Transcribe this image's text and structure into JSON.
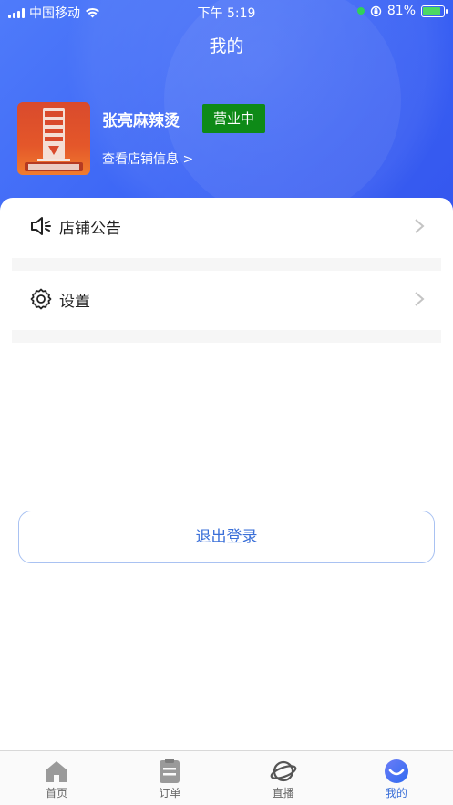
{
  "status_bar": {
    "carrier": "中国移动",
    "time": "下午 5:19",
    "battery": "81%",
    "battery_level": 0.81
  },
  "header": {
    "title": "我的"
  },
  "store": {
    "name": "张亮麻辣烫",
    "status": "营业中",
    "info_link": "查看店铺信息 >",
    "logo_icon": "zhangliang-malatang-logo"
  },
  "menu": {
    "items": [
      {
        "label": "店铺公告",
        "icon": "speaker-icon"
      },
      {
        "label": "设置",
        "icon": "gear-icon"
      }
    ]
  },
  "logout_label": "退出登录",
  "tabbar": {
    "tabs": [
      {
        "label": "首页",
        "icon": "home-icon",
        "active": false
      },
      {
        "label": "订单",
        "icon": "order-icon",
        "active": false
      },
      {
        "label": "直播",
        "icon": "planet-icon",
        "active": false
      },
      {
        "label": "我的",
        "icon": "profile-icon",
        "active": true
      }
    ]
  },
  "colors": {
    "primary": "#3a63f5",
    "status_green": "#0e8a17",
    "link_blue": "#3a6fd8"
  }
}
